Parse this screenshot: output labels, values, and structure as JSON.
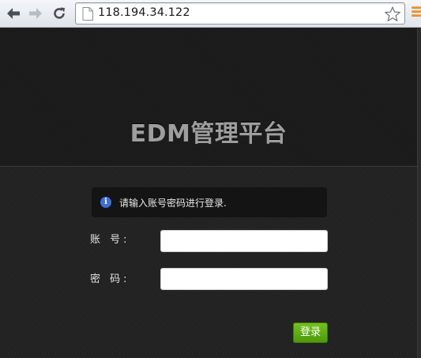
{
  "browser": {
    "url": "118.194.34.122"
  },
  "page": {
    "title": "EDM管理平台",
    "info_message": "请输入账号密码进行登录.",
    "account_label": "账 号:",
    "password_label": "密 码:",
    "account_value": "",
    "password_value": "",
    "login_button": "登录"
  },
  "colors": {
    "button_green": "#5fac14",
    "info_icon_blue": "#3e6fd6",
    "page_background": "#232323"
  },
  "icons": {
    "back": "back-arrow-icon",
    "forward": "forward-arrow-icon",
    "reload": "reload-icon",
    "page": "page-icon",
    "star": "star-icon",
    "menu": "menu-icon",
    "info": "info-icon"
  }
}
